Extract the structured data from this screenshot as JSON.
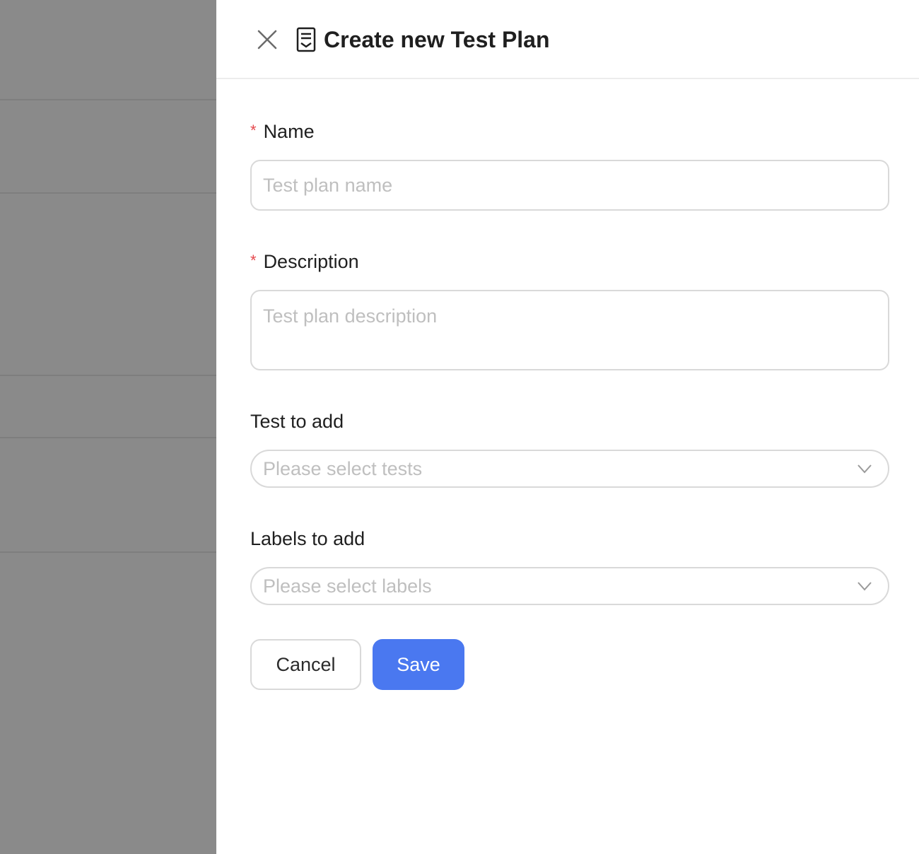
{
  "drawer": {
    "title": "Create new Test Plan",
    "close_icon": "close-icon",
    "title_icon": "document-check-icon"
  },
  "form": {
    "name": {
      "label": "Name",
      "required_marker": "*",
      "value": "",
      "placeholder": "Test plan name"
    },
    "description": {
      "label": "Description",
      "required_marker": "*",
      "value": "",
      "placeholder": "Test plan description"
    },
    "tests": {
      "label": "Test to add",
      "placeholder": "Please select tests"
    },
    "labels": {
      "label": "Labels to add",
      "placeholder": "Please select labels"
    }
  },
  "actions": {
    "cancel_label": "Cancel",
    "save_label": "Save"
  },
  "colors": {
    "primary": "#4a78f0",
    "required": "#e5484d",
    "overlay": "#8a8a8a"
  }
}
